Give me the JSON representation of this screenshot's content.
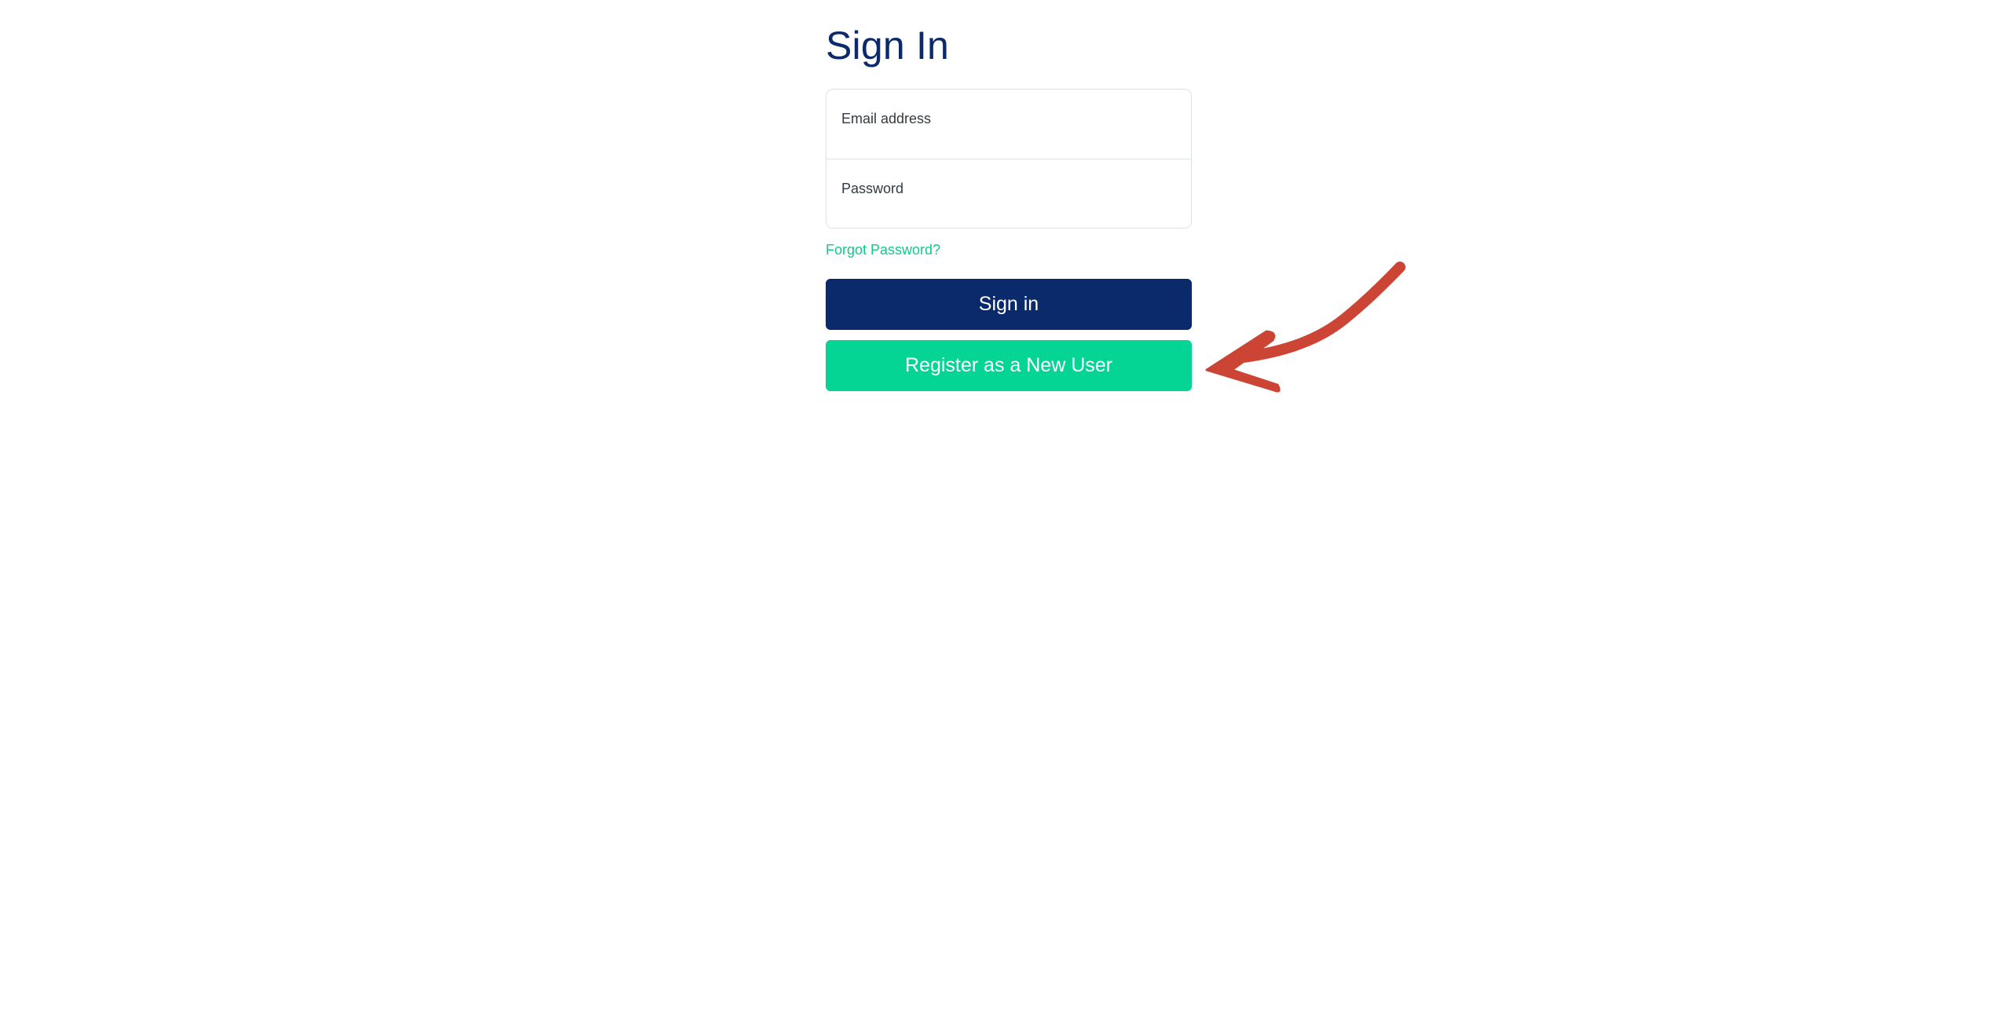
{
  "signin": {
    "title": "Sign In",
    "email_label": "Email address",
    "password_label": "Password",
    "forgot_link": "Forgot Password?",
    "signin_button": "Sign in",
    "register_button": "Register as a New User"
  },
  "colors": {
    "primary_navy": "#0b2a6b",
    "accent_green": "#04d494",
    "link_green": "#13c98c",
    "annotation_red": "#cc4433"
  },
  "icons": {
    "annotation": "red-arrow-icon"
  }
}
